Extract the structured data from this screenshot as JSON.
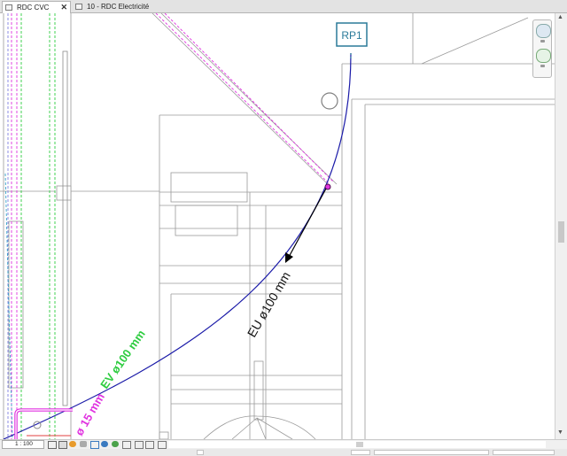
{
  "tabs": [
    {
      "label": "RDC CVC",
      "active": true,
      "close": "✕"
    },
    {
      "label": "10 - RDC Electricité",
      "active": false
    }
  ],
  "drawing": {
    "tag_label": "RP1",
    "pipe_eu_label": "EU ø100 mm",
    "pipe_ev_label": "EV ø100 mm",
    "pipe_small_label": "ø 15 mm"
  },
  "status": {
    "scale": "1 : 100"
  },
  "colors": {
    "curve": "#1a1aa8",
    "ev_green": "#2ecc40",
    "magenta": "#e034e0",
    "tag": "#2a7a99"
  }
}
